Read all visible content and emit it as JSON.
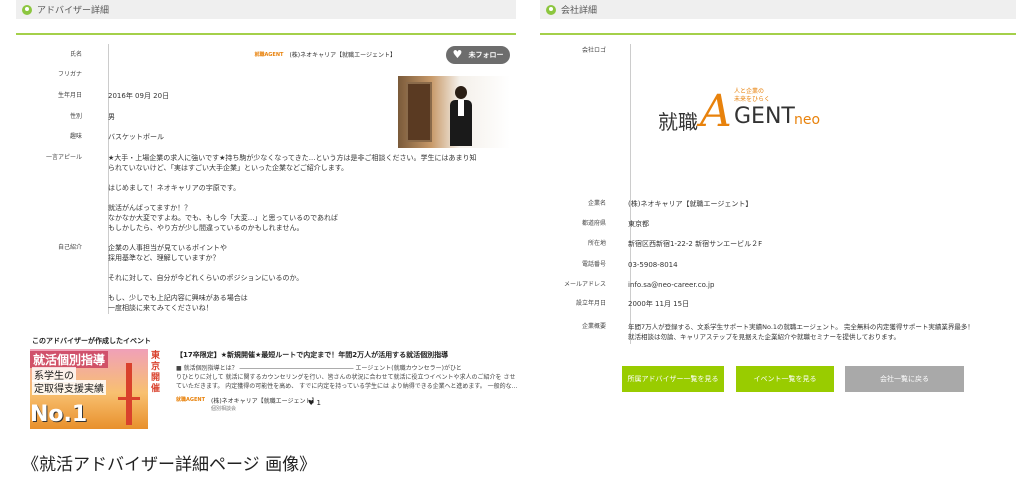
{
  "left": {
    "header_title": "アドバイザー詳細",
    "fields": [
      {
        "label": "氏名",
        "value": ""
      },
      {
        "label": "フリガナ",
        "value": ""
      },
      {
        "label": "生年月日",
        "value": "2016年 09月 20日"
      },
      {
        "label": "性別",
        "value": "男"
      },
      {
        "label": "趣味",
        "value": "バスケットボール"
      }
    ],
    "company_name": "(株)ネオキャリア【就職エージェント】",
    "company_logo_text": "就職AGENT",
    "follow_label": "未フォロー",
    "appeal_label": "一言アピール",
    "appeal_lines": [
      "★大手・上場企業の求人に強いです★持ち駒が少なくなってきた...という方は是非ご相談ください。学生にはあまり知",
      "られていないけど、「実はすごい大手企業」といった企業などご紹介します。",
      "",
      "はじめまして！ネオキャリアの宇原です。",
      "",
      "就活がんばってますか！？",
      "なかなか大変ですよね。でも、もし今「大変...」と思っているのであれば",
      "もしかしたら、やり方が少し間違っているのかもしれません。"
    ],
    "intro_label": "自己紹介",
    "intro_lines": [
      "企業の人事担当が見ているポイントや",
      "採用基準など、理解していますか？",
      "",
      "それに対して、自分が今どれくらいのポジションにいるのか。",
      "",
      "もし、少しでも上記内容に興味がある場合は",
      "一度相談に来てみてくださいね！"
    ],
    "event_section_title": "このアドバイザーが作成したイベント",
    "event": {
      "thumb_line1": "就活個別指導",
      "thumb_line2": "系学生の",
      "thumb_line3": "定取得支援実績",
      "thumb_line4": "No.1",
      "thumb_side": "東京開催",
      "headline": "【17卒限定】★新規開催★最短ルートで内定まで！年間2万人が活用する就活個別指導",
      "body_line1": "■ 就活個別指導とは？ ――――――――――――――――――― エージェント(就職カウンセラー)がひと",
      "body_line2": "りひとりに対して 就活に関するカウンセリングを行い、皆さんの状況に合わせて就活に役立つイベントや求人のご紹介を させ",
      "body_line3": "ていただきます。 内定獲得の可能性を高め、 すでに内定を持っている学生には より納得できる企業へと進めます。 一般的な...",
      "footer_company": "(株)ネオキャリア【就職エージェント】",
      "footer_sub": "個別相談会",
      "like_count": "1"
    }
  },
  "right": {
    "header_title": "会社詳細",
    "logo_label": "会社ロゴ",
    "logo": {
      "kanji": "就職",
      "letter": "A",
      "gent": "GENT",
      "neo": "neo",
      "tag_line1": "人と企業の",
      "tag_line2": "未来をひらく"
    },
    "fields": [
      {
        "label": "企業名",
        "value": "(株)ネオキャリア【就職エージェント】"
      },
      {
        "label": "都道府県",
        "value": "東京都"
      },
      {
        "label": "所在地",
        "value": "新宿区西新宿1-22-2 新宿サンエービル２F"
      },
      {
        "label": "電話番号",
        "value": "03-5908-8014"
      },
      {
        "label": "メールアドレス",
        "value": "info.sa@neo-career.co.jp"
      },
      {
        "label": "設立年月日",
        "value": "2000年 11月 15日"
      }
    ],
    "summary_label": "企業概要",
    "summary_line1": "年間7万人が登録する、文系学生サポート実績No.1の就職エージェント。 完全無料の内定獲得サポート実績業界最多！",
    "summary_line2": "就活相談は勿論、キャリアステップを見据えた企業紹介や就職セミナーを提供しております。",
    "buttons": {
      "advisors": "所属アドバイザー一覧を見る",
      "events": "イベント一覧を見る",
      "back": "会社一覧に戻る"
    }
  },
  "caption": "《就活アドバイザー詳細ページ 画像》",
  "colors": {
    "accent_green": "#99cc00",
    "header_bg": "#efefef",
    "brand_orange": "#e8820c",
    "follow_button": "#6d6d6d",
    "back_button": "#a9a9a9"
  }
}
